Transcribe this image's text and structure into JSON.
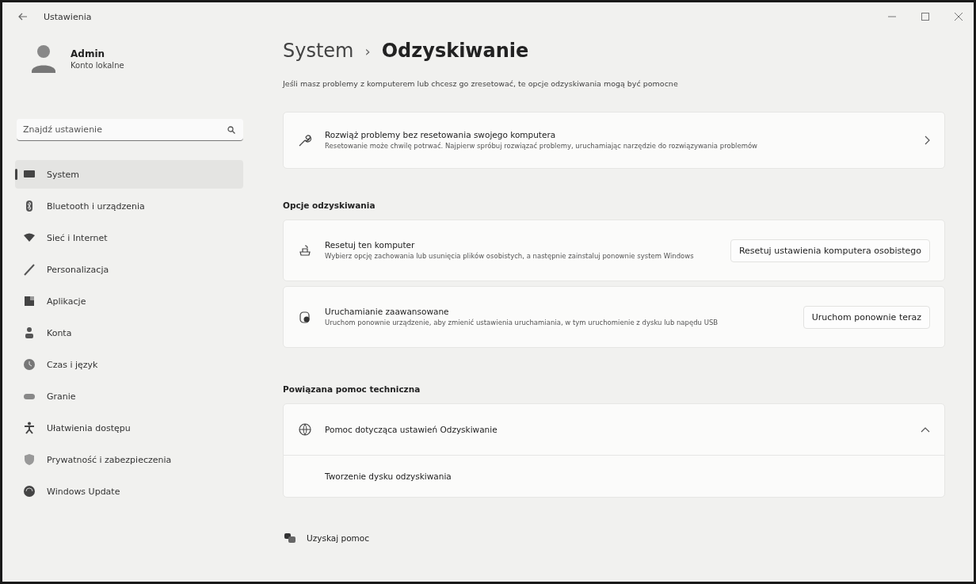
{
  "window": {
    "title": "Ustawienia"
  },
  "user": {
    "name": "Admin",
    "account": "Konto lokalne"
  },
  "search": {
    "placeholder": "Znajdź ustawienie"
  },
  "sidebar": {
    "items": [
      {
        "label": "System",
        "selected": true
      },
      {
        "label": "Bluetooth i urządzenia",
        "selected": false
      },
      {
        "label": "Sieć i Internet",
        "selected": false
      },
      {
        "label": "Personalizacja",
        "selected": false
      },
      {
        "label": "Aplikacje",
        "selected": false
      },
      {
        "label": "Konta",
        "selected": false
      },
      {
        "label": "Czas i język",
        "selected": false
      },
      {
        "label": "Granie",
        "selected": false
      },
      {
        "label": "Ułatwienia dostępu",
        "selected": false
      },
      {
        "label": "Prywatność i zabezpieczenia",
        "selected": false
      },
      {
        "label": "Windows Update",
        "selected": false
      }
    ]
  },
  "breadcrumb": {
    "parent": "System",
    "separator": "›",
    "current": "Odzyskiwanie"
  },
  "description": "Jeśli masz problemy z komputerem lub chcesz go zresetować, te opcje odzyskiwania mogą być pomocne",
  "troubleshoot": {
    "title": "Rozwiąż problemy bez resetowania swojego komputera",
    "subtitle": "Resetowanie może chwilę potrwać. Najpierw spróbuj rozwiązać problemy, uruchamiając narzędzie do rozwiązywania problemów"
  },
  "recovery_options": {
    "heading": "Opcje odzyskiwania",
    "items": [
      {
        "title": "Resetuj ten komputer",
        "subtitle": "Wybierz opcję zachowania lub usunięcia plików osobistych, a następnie zainstaluj ponownie system Windows",
        "button": "Resetuj ustawienia komputera osobistego"
      },
      {
        "title": "Uruchamianie zaawansowane",
        "subtitle": "Uruchom ponownie urządzenie, aby zmienić ustawienia uruchamiania, w tym uruchomienie z dysku lub napędu USB",
        "button": "Uruchom ponownie teraz"
      }
    ]
  },
  "related_help": {
    "heading": "Powiązana pomoc techniczna",
    "title": "Pomoc dotycząca ustawień Odzyskiwanie",
    "expanded": true,
    "links": [
      "Tworzenie dysku odzyskiwania"
    ]
  },
  "footer_links": [
    "Uzyskaj pomoc"
  ]
}
